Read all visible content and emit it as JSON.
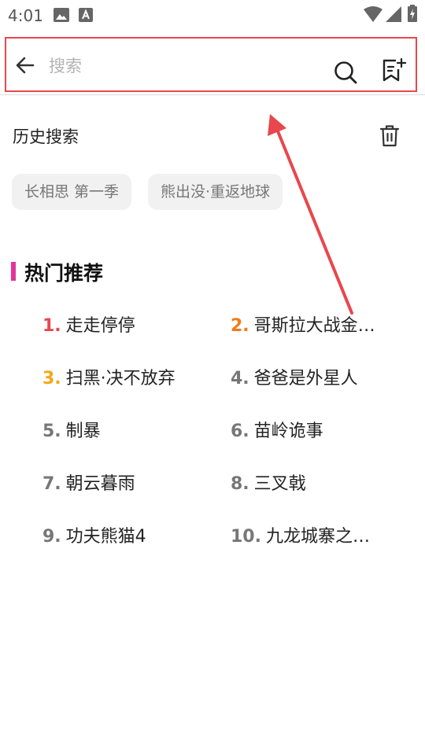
{
  "status_bar": {
    "time": "4:01",
    "icons": [
      "image-icon",
      "a-notification-icon",
      "wifi-icon",
      "signal-icon",
      "battery-charging-icon"
    ]
  },
  "search": {
    "placeholder": "搜索",
    "value": "",
    "border_color": "#e8474d"
  },
  "history": {
    "title": "历史搜索",
    "chips": [
      "长相思 第一季",
      "熊出没·重返地球"
    ]
  },
  "hot": {
    "title": "热门推荐",
    "accent_color": "#e0369b",
    "items": [
      {
        "rank": "1.",
        "title": "走走停停",
        "rank_color": "#e8474d"
      },
      {
        "rank": "2.",
        "title": "哥斯拉大战金…",
        "rank_color": "#f07b1a"
      },
      {
        "rank": "3.",
        "title": "扫黑·决不放弃",
        "rank_color": "#f2a81a"
      },
      {
        "rank": "4.",
        "title": "爸爸是外星人",
        "rank_color": "#777777"
      },
      {
        "rank": "5.",
        "title": "制暴",
        "rank_color": "#777777"
      },
      {
        "rank": "6.",
        "title": "苗岭诡事",
        "rank_color": "#777777"
      },
      {
        "rank": "7.",
        "title": "朝云暮雨",
        "rank_color": "#777777"
      },
      {
        "rank": "8.",
        "title": "三叉戟",
        "rank_color": "#777777"
      },
      {
        "rank": "9.",
        "title": "功夫熊猫4",
        "rank_color": "#777777"
      },
      {
        "rank": "10.",
        "title": "九龙城寨之…",
        "rank_color": "#777777"
      }
    ]
  }
}
